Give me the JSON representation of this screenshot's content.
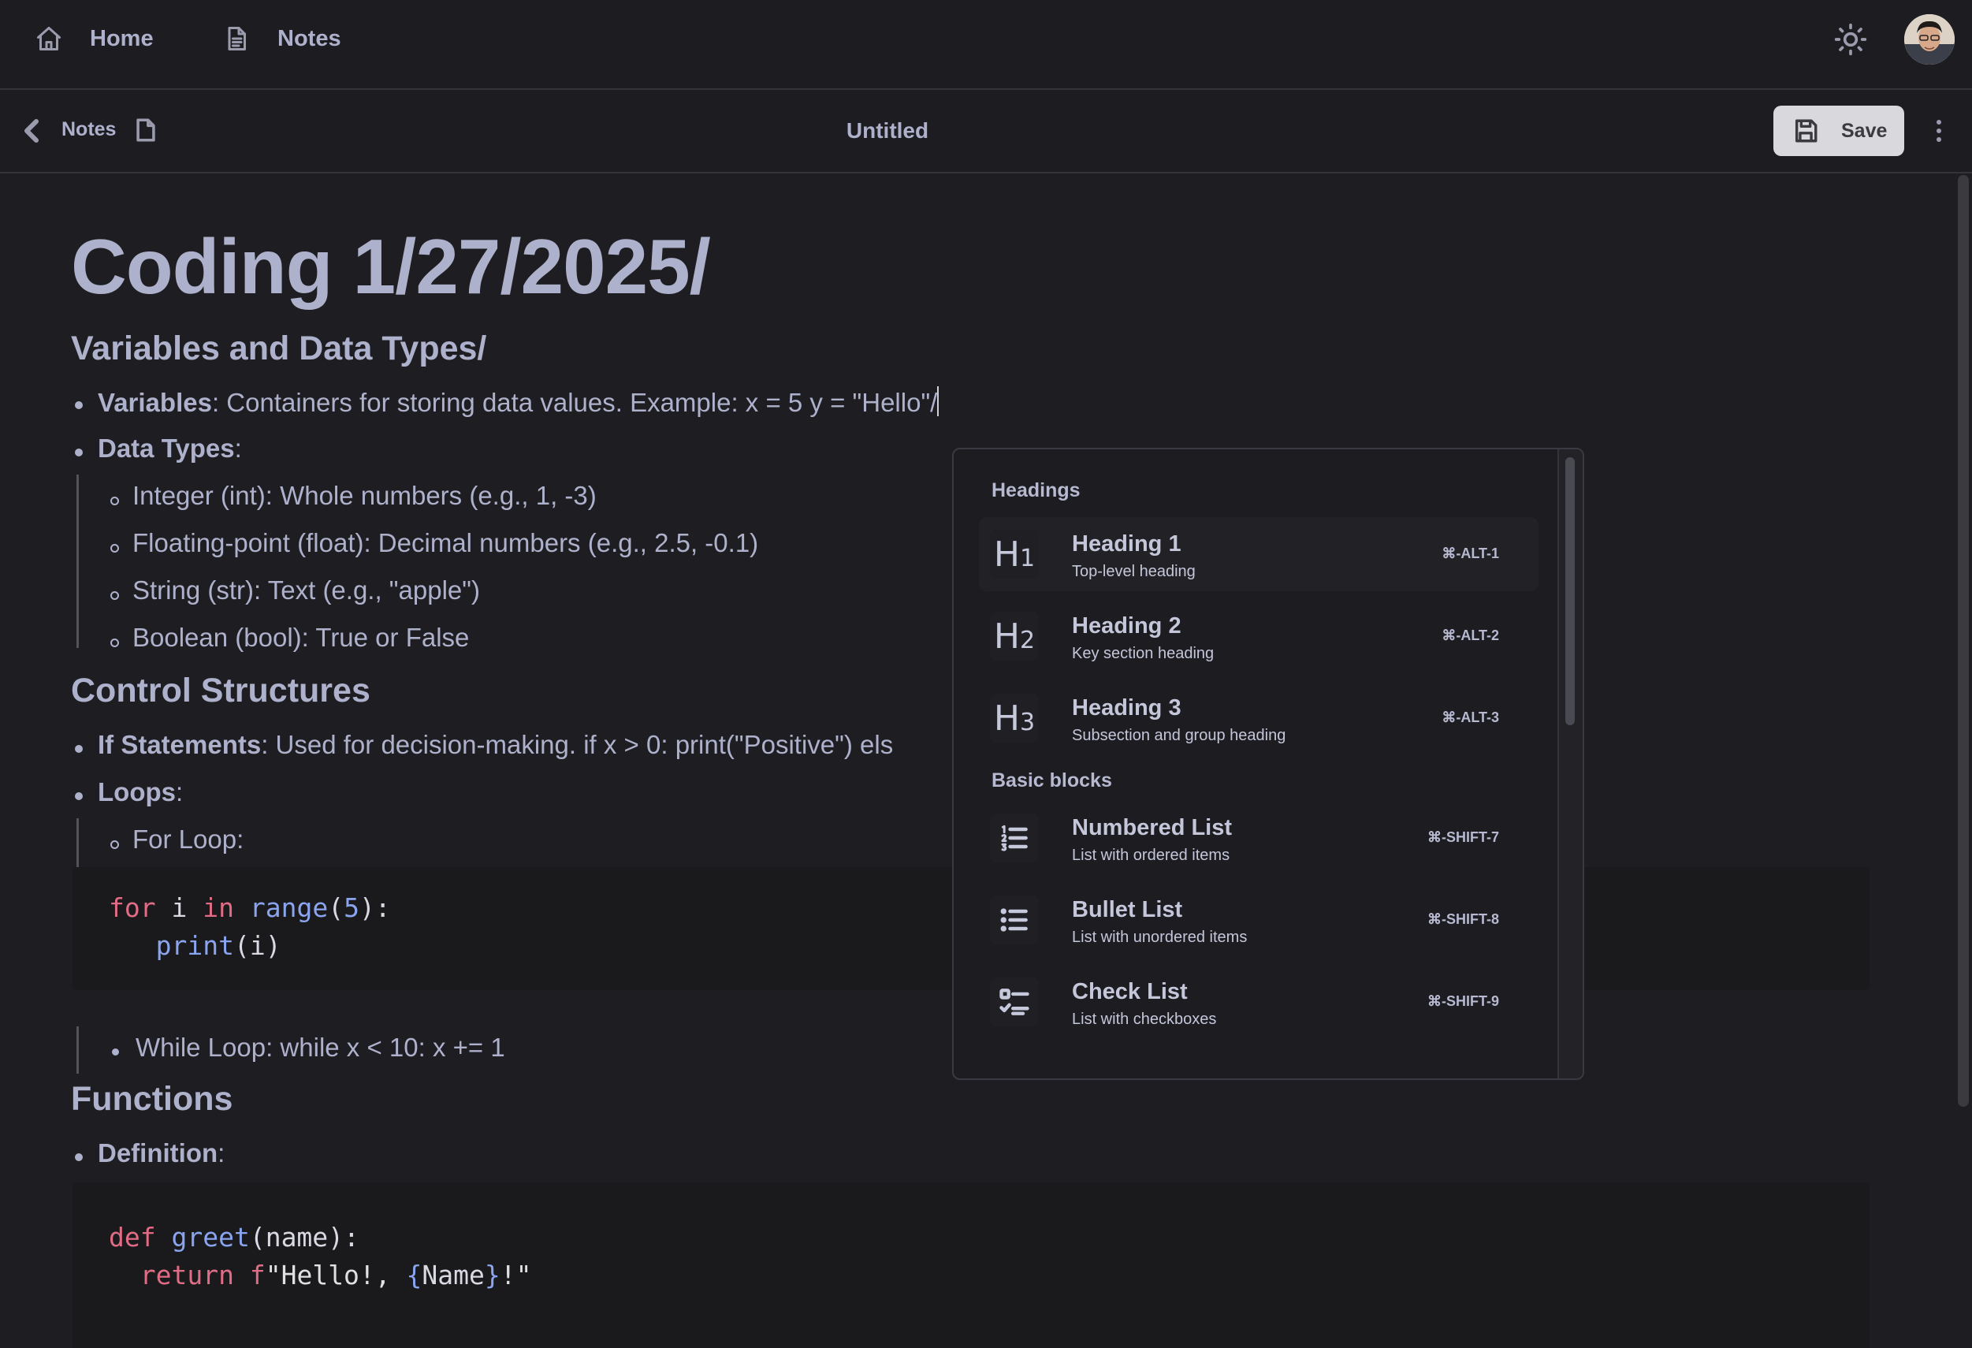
{
  "nav": {
    "home_label": "Home",
    "notes_label": "Notes"
  },
  "toolbar": {
    "breadcrumb": "Notes",
    "doc_title": "Untitled",
    "save_label": "Save"
  },
  "doc": {
    "title": "Coding 1/27/2025/",
    "sec1": {
      "heading": "Variables and Data Types/",
      "variables_term": "Variables",
      "variables_text": ": Containers for storing data values. Example: x = 5 y = \"Hello\"/",
      "datatypes_term": "Data Types",
      "datatypes_colon": ":",
      "types": [
        "Integer (int): Whole numbers (e.g., 1, -3)",
        "Floating-point (float): Decimal numbers (e.g., 2.5, -0.1)",
        "String (str): Text (e.g., \"apple\")",
        "Boolean (bool): True or False"
      ]
    },
    "sec2": {
      "heading": "Control Structures",
      "if_term": "If Statements",
      "if_text": ": Used for decision-making. if x > 0:     print(\"Positive\") els",
      "loops_term": "Loops",
      "loops_colon": ":",
      "for_loop": "For Loop:",
      "code_for": {
        "kw_for": "for",
        "var_i": " i ",
        "kw_in": "in",
        "space": " ",
        "fn_range": "range",
        "lp": "(",
        "num_5": "5",
        "rp_colon": "):",
        "indent": "   ",
        "fn_print": "print",
        "arg": "(i)"
      },
      "while_loop": "While Loop: while x < 10:     x += 1"
    },
    "sec3": {
      "heading": "Functions",
      "def_term": "Definition",
      "def_colon": ":",
      "code_def": {
        "kw_def": "def",
        "space": " ",
        "fn_greet": "greet",
        "params": "(name):",
        "indent": "  ",
        "kw_return": "return",
        "fstr_prefix": " f",
        "str_open": "\"Hello!, ",
        "brace_open": "{",
        "var_name": "Name",
        "brace_close": "}",
        "str_close": "!\""
      }
    }
  },
  "slash_menu": {
    "groups": [
      {
        "label": "Headings"
      },
      {
        "label": "Basic blocks"
      }
    ],
    "items": [
      {
        "glyph": "H",
        "glyph_sub": "1",
        "title": "Heading 1",
        "subtitle": "Top-level heading",
        "shortcut": "⌘-ALT-1"
      },
      {
        "glyph": "H",
        "glyph_sub": "2",
        "title": "Heading 2",
        "subtitle": "Key section heading",
        "shortcut": "⌘-ALT-2"
      },
      {
        "glyph": "H",
        "glyph_sub": "3",
        "title": "Heading 3",
        "subtitle": "Subsection and group heading",
        "shortcut": "⌘-ALT-3"
      },
      {
        "icon": "numbered-list-icon",
        "title": "Numbered List",
        "subtitle": "List with ordered items",
        "shortcut": "⌘-SHIFT-7"
      },
      {
        "icon": "bullet-list-icon",
        "title": "Bullet List",
        "subtitle": "List with unordered items",
        "shortcut": "⌘-SHIFT-8"
      },
      {
        "icon": "check-list-icon",
        "title": "Check List",
        "subtitle": "List with checkboxes",
        "shortcut": "⌘-SHIFT-9"
      }
    ]
  }
}
